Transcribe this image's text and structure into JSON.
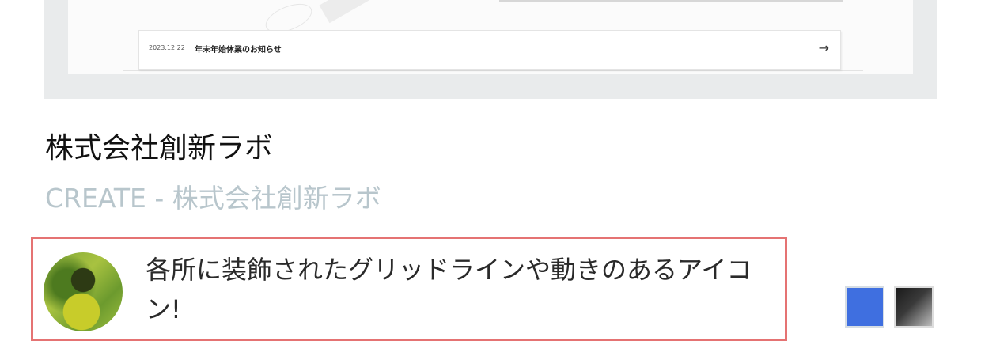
{
  "preview": {
    "news_date": "2023.12.22",
    "news_title": "年末年始休業のお知らせ",
    "news_arrow": "→"
  },
  "site": {
    "title": "株式会社創新ラボ",
    "subtitle": "CREATE - 株式会社創新ラボ"
  },
  "comment": {
    "text": "各所に装飾されたグリッドラインや動きのあるアイコン!"
  },
  "colors": {
    "highlight_border": "#e57373",
    "subtitle_text": "#b8c6cc",
    "swatches": [
      "#3f6fe0",
      "#1a1a1a"
    ]
  },
  "icons": {
    "news_arrow": "arrow-right-icon"
  }
}
